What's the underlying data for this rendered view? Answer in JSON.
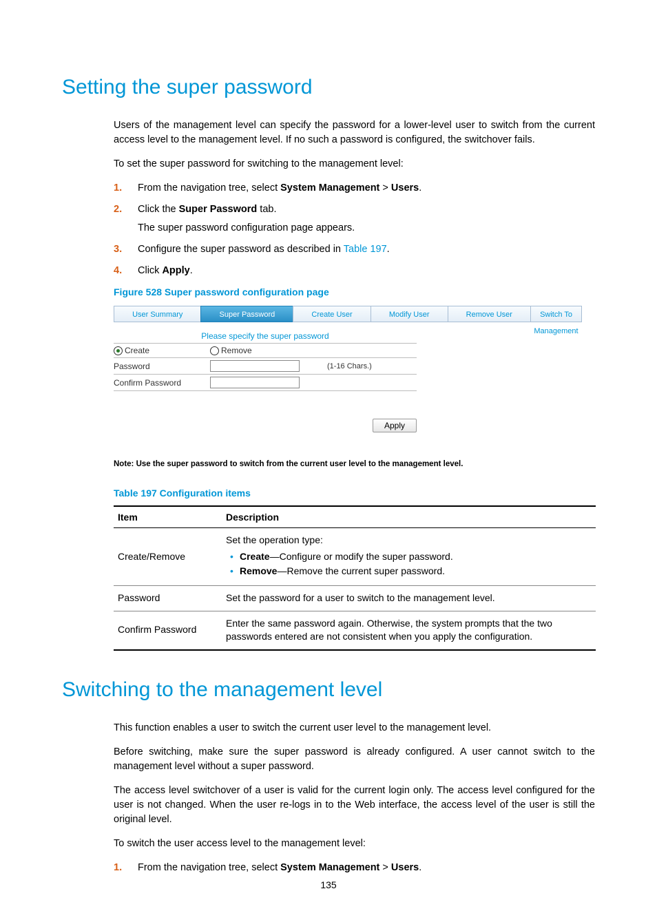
{
  "section1": {
    "title": "Setting the super password",
    "intro": "Users of the management level can specify the password for a lower-level user to switch from the current access level to the management level. If no such a password is configured, the switchover fails.",
    "lead": "To set the super password for switching to the management level:",
    "steps": {
      "s1a": "From the navigation tree, select ",
      "s1b": "System Management",
      "s1c": " > ",
      "s1d": "Users",
      "s1e": ".",
      "s2a": "Click the ",
      "s2b": "Super Password",
      "s2c": " tab.",
      "s2sub": "The super password configuration page appears.",
      "s3a": "Configure the super password as described in ",
      "s3link": "Table 197",
      "s3b": ".",
      "s4a": "Click ",
      "s4b": "Apply",
      "s4c": "."
    },
    "figcaption": "Figure 528 Super password configuration page"
  },
  "fig": {
    "tabs": {
      "t1": "User Summary",
      "t2": "Super Password",
      "t3": "Create User",
      "t4": "Modify User",
      "t5": "Remove User",
      "t6": "Switch To Management"
    },
    "specify": "Please specify the super password",
    "create": "Create",
    "remove": "Remove",
    "password": "Password",
    "hint": "(1-16 Chars.)",
    "confirm": "Confirm Password",
    "apply": "Apply",
    "note": "Note: Use the super password to switch from the current user level to the management level."
  },
  "table": {
    "caption": "Table 197 Configuration items",
    "h1": "Item",
    "h2": "Description",
    "r1c1": "Create/Remove",
    "r1lead": "Set the operation type:",
    "r1b1a": "Create",
    "r1b1b": "—Configure or modify the super password.",
    "r1b2a": "Remove",
    "r1b2b": "—Remove the current super password.",
    "r2c1": "Password",
    "r2c2": "Set the password for a user to switch to the management level.",
    "r3c1": "Confirm Password",
    "r3c2": "Enter the same password again. Otherwise, the system prompts that the two passwords entered are not consistent when you apply the configuration."
  },
  "section2": {
    "title": "Switching to the management level",
    "p1": "This function enables a user to switch the current user level to the management level.",
    "p2": "Before switching, make sure the super password is already configured. A user cannot switch to the management level without a super password.",
    "p3": "The access level switchover of a user is valid for the current login only. The access level configured for the user is not changed. When the user re-logs in to the Web interface, the access level of the user is still the original level.",
    "p4": "To switch the user access level to the management level:",
    "s1a": "From the navigation tree, select ",
    "s1b": "System Management",
    "s1c": " > ",
    "s1d": "Users",
    "s1e": "."
  },
  "pagenum": "135"
}
